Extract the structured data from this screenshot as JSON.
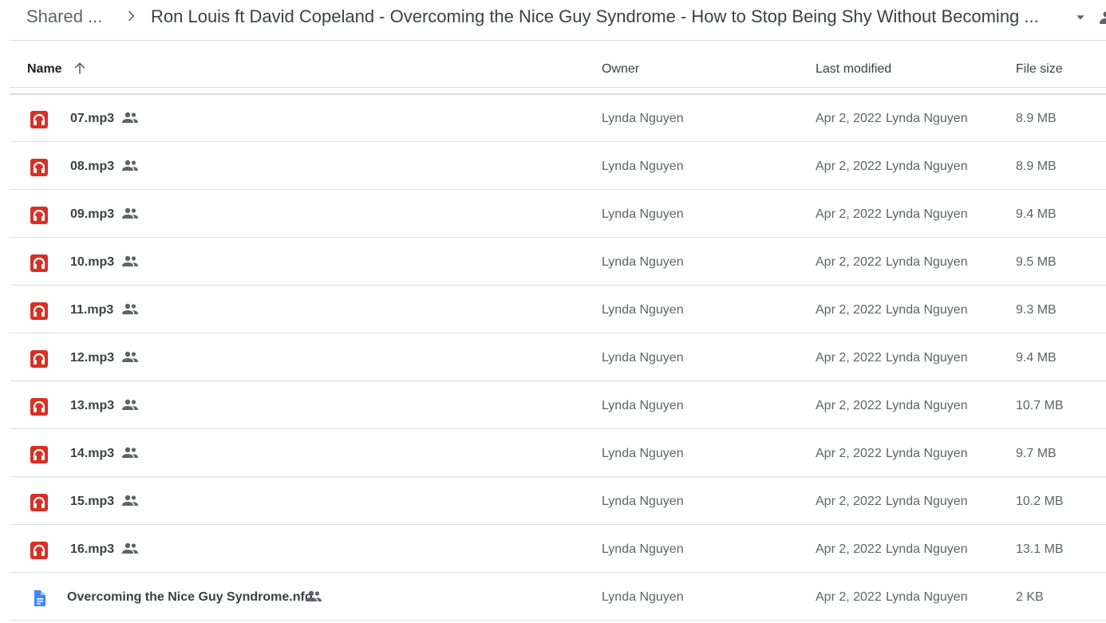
{
  "breadcrumb": {
    "root": "Shared ...",
    "current": "Ron Louis ft David Copeland - Overcoming the Nice Guy Syndrome - How to Stop Being Shy Without Becoming ..."
  },
  "columns": {
    "name": "Name",
    "owner": "Owner",
    "modified": "Last modified",
    "size": "File size"
  },
  "files": [
    {
      "name": "07.mp3",
      "type": "audio",
      "owner": "Lynda Nguyen",
      "date": "Apr 2, 2022",
      "modified_by": "Lynda Nguyen",
      "size": "8.9 MB"
    },
    {
      "name": "08.mp3",
      "type": "audio",
      "owner": "Lynda Nguyen",
      "date": "Apr 2, 2022",
      "modified_by": "Lynda Nguyen",
      "size": "8.9 MB"
    },
    {
      "name": "09.mp3",
      "type": "audio",
      "owner": "Lynda Nguyen",
      "date": "Apr 2, 2022",
      "modified_by": "Lynda Nguyen",
      "size": "9.4 MB"
    },
    {
      "name": "10.mp3",
      "type": "audio",
      "owner": "Lynda Nguyen",
      "date": "Apr 2, 2022",
      "modified_by": "Lynda Nguyen",
      "size": "9.5 MB"
    },
    {
      "name": "11.mp3",
      "type": "audio",
      "owner": "Lynda Nguyen",
      "date": "Apr 2, 2022",
      "modified_by": "Lynda Nguyen",
      "size": "9.3 MB"
    },
    {
      "name": "12.mp3",
      "type": "audio",
      "owner": "Lynda Nguyen",
      "date": "Apr 2, 2022",
      "modified_by": "Lynda Nguyen",
      "size": "9.4 MB"
    },
    {
      "name": "13.mp3",
      "type": "audio",
      "owner": "Lynda Nguyen",
      "date": "Apr 2, 2022",
      "modified_by": "Lynda Nguyen",
      "size": "10.7 MB"
    },
    {
      "name": "14.mp3",
      "type": "audio",
      "owner": "Lynda Nguyen",
      "date": "Apr 2, 2022",
      "modified_by": "Lynda Nguyen",
      "size": "9.7 MB"
    },
    {
      "name": "15.mp3",
      "type": "audio",
      "owner": "Lynda Nguyen",
      "date": "Apr 2, 2022",
      "modified_by": "Lynda Nguyen",
      "size": "10.2 MB"
    },
    {
      "name": "16.mp3",
      "type": "audio",
      "owner": "Lynda Nguyen",
      "date": "Apr 2, 2022",
      "modified_by": "Lynda Nguyen",
      "size": "13.1 MB"
    },
    {
      "name": "Overcoming the Nice Guy Syndrome.nfo",
      "type": "document",
      "owner": "Lynda Nguyen",
      "date": "Apr 2, 2022",
      "modified_by": "Lynda Nguyen",
      "size": "2 KB"
    }
  ],
  "icons": {
    "audio": "audio-file-icon",
    "document": "document-file-icon",
    "shared": "shared-people-icon",
    "sort": "arrow-up-icon"
  },
  "colors": {
    "audio_icon": "#d93025",
    "document_icon": "#4285f4",
    "divider": "#dadce0",
    "muted_text": "#5f6368"
  }
}
